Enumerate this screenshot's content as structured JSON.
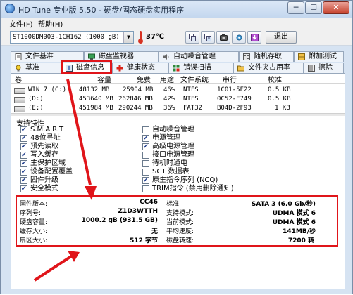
{
  "window": {
    "title": "HD Tune 专业版 5.50 - 硬盘/固态硬盘实用程序",
    "controls": {
      "minimize": "─",
      "maximize": "☐",
      "close": "✕"
    }
  },
  "menu": {
    "file": "文件(F)",
    "help": "帮助(H)"
  },
  "toolbar": {
    "drive": "ST1000DM003-1CH162 (1000 gB)",
    "temperature": "37℃",
    "exit_label": "退出"
  },
  "tabs_top": [
    "文件基准",
    "磁盘监视器",
    "自动噪音管理",
    "随机存取",
    "附加测试"
  ],
  "tabs_bottom": [
    "基准",
    "磁盘信息",
    "健康状态",
    "错误扫描",
    "文件夹占用率",
    "擦除"
  ],
  "active_tab": "磁盘信息",
  "volumes": {
    "headers": [
      "卷",
      "容量",
      "免费",
      "用途",
      "文件系统",
      "串行",
      "校准"
    ],
    "rows": [
      [
        "WIN 7 (C:)",
        "48132 MB",
        "25904 MB",
        "46%",
        "NTFS",
        "1C01-5F22",
        "0.5 KB"
      ],
      [
        "(D:)",
        "453640 MB",
        "262846 MB",
        "42%",
        "NTFS",
        "0C52-E749",
        "0.5 KB"
      ],
      [
        "(E:)",
        "451984 MB",
        "290244 MB",
        "36%",
        "FAT32",
        "B04D-2F93",
        "1 KB"
      ]
    ]
  },
  "features": {
    "title": "支持特性",
    "left": [
      {
        "label": "S.M.A.R.T",
        "checked": true
      },
      {
        "label": "48位寻址",
        "checked": true
      },
      {
        "label": "预先读取",
        "checked": true
      },
      {
        "label": "写入缓存",
        "checked": true
      },
      {
        "label": "主保护区域",
        "checked": true
      },
      {
        "label": "设备配置覆盖",
        "checked": true
      },
      {
        "label": "固件升级",
        "checked": true
      },
      {
        "label": "安全模式",
        "checked": true
      }
    ],
    "right": [
      {
        "label": "自动噪音管理",
        "checked": false
      },
      {
        "label": "电源管理",
        "checked": true
      },
      {
        "label": "高级电源管理",
        "checked": true
      },
      {
        "label": "接口电源管理",
        "checked": false
      },
      {
        "label": "待机时通电",
        "checked": false
      },
      {
        "label": "SCT 数据表",
        "checked": false
      },
      {
        "label": "原生指令序列 (NCQ)",
        "checked": true
      },
      {
        "label": "TRIM指令 (禁用删除通知)",
        "checked": false
      }
    ]
  },
  "info": {
    "firmware_label": "固件版本:",
    "firmware": "CC46",
    "serial_label": "序列号:",
    "serial": "Z1D3WTTH",
    "capacity_label": "硬盘容量:",
    "capacity": "1000.2 gB (931.5 GB)",
    "cache_label": "缓存大小:",
    "cache": "无",
    "sector_label": "扇区大小:",
    "sector": "512 字节",
    "standard_label": "标准:",
    "standard": "SATA 3 (6.0 Gb/秒)",
    "supported_mode_label": "支持模式:",
    "supported_mode": "UDMA 模式 6",
    "current_mode_label": "当前模式:",
    "current_mode": "UDMA 模式 6",
    "avg_speed_label": "平均速度:",
    "avg_speed": "141MB/秒",
    "rpm_label": "磁盘转速:",
    "rpm": "7200 转"
  },
  "colors": {
    "highlight": "#e0151a",
    "window_bg": "#d6e3f2"
  }
}
